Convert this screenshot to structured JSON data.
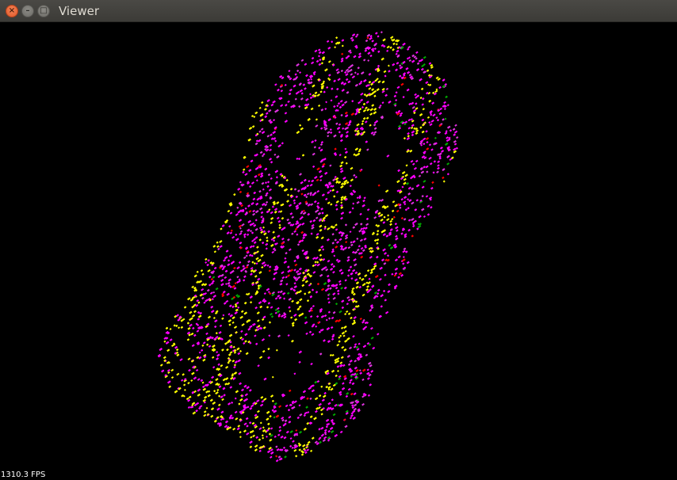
{
  "window": {
    "title": "Viewer",
    "close_glyph": "×",
    "minimize_glyph": "–",
    "maximize_glyph": "□"
  },
  "viewport": {
    "background": "#000000",
    "fps_text": "1310.3 FPS",
    "point_colors": [
      "#ff00ff",
      "#ffff00",
      "#ff0000",
      "#00aa00",
      "#dd33dd"
    ]
  }
}
